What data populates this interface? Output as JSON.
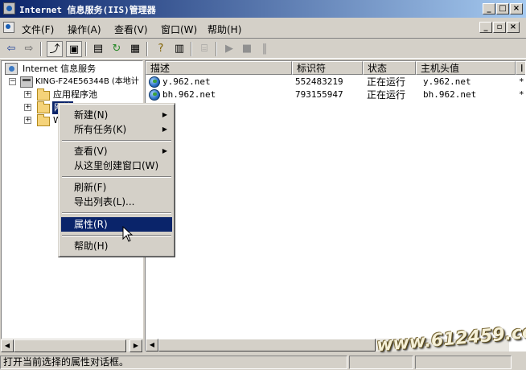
{
  "window": {
    "title": "Internet 信息服务(IIS)管理器"
  },
  "menu": {
    "items": [
      {
        "label": "文件(F)"
      },
      {
        "label": "操作(A)"
      },
      {
        "label": "查看(V)"
      },
      {
        "label": "窗口(W)"
      },
      {
        "label": "帮助(H)"
      }
    ]
  },
  "tree": {
    "root": "Internet 信息服务",
    "server": "KING-F24E56344B (本地计",
    "children": [
      {
        "label": "应用程序池"
      },
      {
        "label": "网站"
      },
      {
        "label": "W"
      }
    ]
  },
  "list": {
    "columns": [
      "描述",
      "标识符",
      "状态",
      "主机头值",
      "I"
    ],
    "rows": [
      {
        "description": "y.962.net",
        "id": "552483219",
        "status": "正在运行",
        "host": "y.962.net",
        "extra": "*"
      },
      {
        "description": "bh.962.net",
        "id": "793155947",
        "status": "正在运行",
        "host": "bh.962.net",
        "extra": "*"
      }
    ]
  },
  "context_menu": {
    "items": [
      {
        "label": "新建(N)",
        "submenu": true
      },
      {
        "label": "所有任务(K)",
        "submenu": true
      },
      {
        "label": "查看(V)",
        "submenu": true
      },
      {
        "label": "从这里创建窗口(W)",
        "submenu": false
      },
      {
        "label": "刷新(F)",
        "submenu": false
      },
      {
        "label": "导出列表(L)...",
        "submenu": false
      },
      {
        "label": "属性(R)",
        "submenu": false,
        "selected": true
      },
      {
        "label": "帮助(H)",
        "submenu": false
      }
    ]
  },
  "status": {
    "text": "打开当前选择的属性对话框。"
  },
  "watermark": "www.612459.com",
  "colors": {
    "titlebar": "#0a246a",
    "selection": "#0a246a",
    "face": "#d4d0c8"
  }
}
